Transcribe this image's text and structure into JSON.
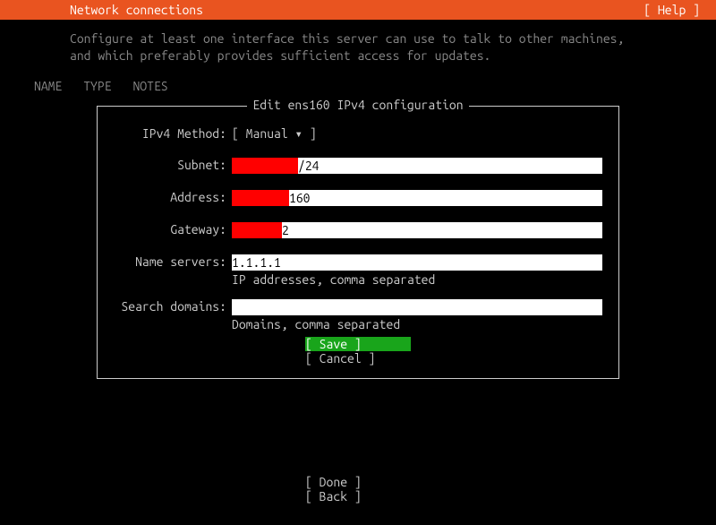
{
  "topbar": {
    "title": "Network connections",
    "help": "[ Help ]"
  },
  "description": "Configure at least one interface this server can use to talk to other machines, and which preferably provides sufficient access for updates.",
  "columns": {
    "c0": "NAME",
    "c1": "TYPE",
    "c2": "NOTES"
  },
  "dialog": {
    "title": "Edit ens160 IPv4 configuration",
    "method_label": "IPv4 Method:",
    "method_value": "[ Manual            ▾ ]",
    "subnet_label": "Subnet:",
    "subnet_visible": "/24",
    "address_label": "Address:",
    "address_visible": "160",
    "gateway_label": "Gateway:",
    "gateway_visible": "2",
    "ns_label": "Name servers:",
    "ns_value": "1.1.1.1",
    "ns_hint": "IP addresses, comma separated",
    "sd_label": "Search domains:",
    "sd_value": "",
    "sd_hint": "Domains, comma separated",
    "save": "[ Save      ]",
    "cancel": "[ Cancel    ]"
  },
  "footer": {
    "done": "[ Done      ]",
    "back": "[ Back      ]"
  }
}
